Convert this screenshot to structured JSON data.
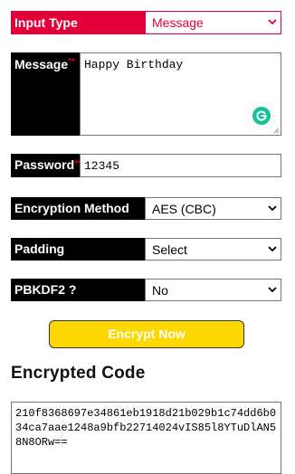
{
  "form": {
    "input_type": {
      "label": "Input Type",
      "selected": "Message"
    },
    "message": {
      "label": "Message",
      "required_mark": "**",
      "value": "Happy Birthday"
    },
    "password": {
      "label": "Password",
      "required_mark": "**",
      "value": "12345"
    },
    "encryption_method": {
      "label": "Encryption Method",
      "selected": "AES (CBC)"
    },
    "padding": {
      "label": "Padding",
      "selected": "Select"
    },
    "pbkdf2": {
      "label": "PBKDF2 ?",
      "selected": "No"
    }
  },
  "encrypt_button": {
    "label": "Encrypt Now"
  },
  "result": {
    "heading": "Encrypted Code",
    "value": "210f8368697e34861eb1918d21b029b1c74dd6b034ca7aae1248a9bfb22714024vIS85l8YTuDlAN58N8ORw=="
  },
  "colors": {
    "accent_red": "#e2003a",
    "label_black": "#000000",
    "required_red": "#d0021b",
    "button_yellow": "#ffd700",
    "grammarly_green": "#15c39a"
  },
  "icons": {
    "select_arrow": "chevron-down-icon",
    "grammarly": "grammarly-icon"
  }
}
